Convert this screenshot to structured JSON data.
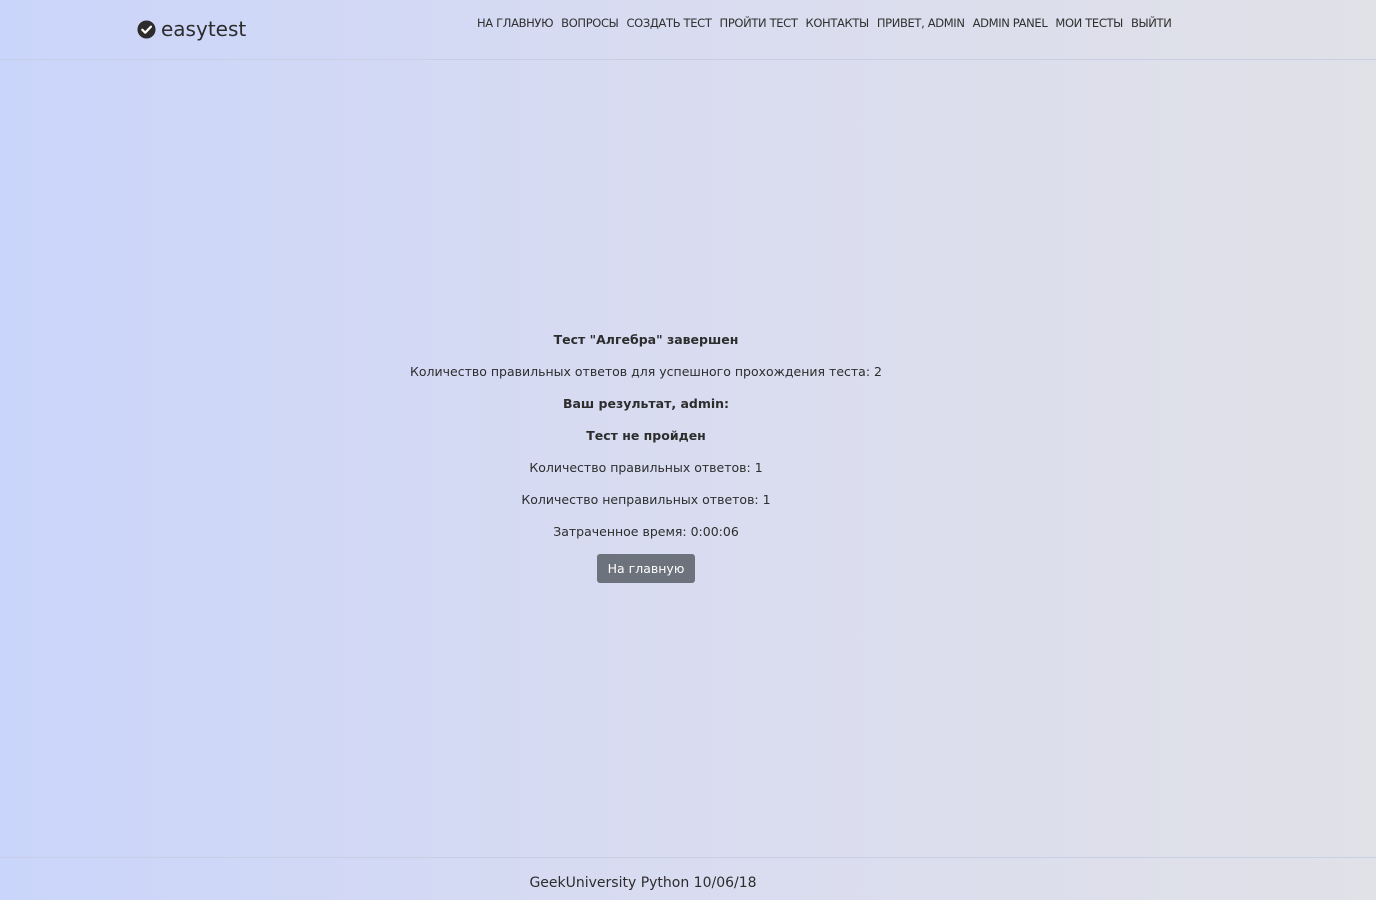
{
  "header": {
    "brand": "easytest",
    "brand_icon": "check-circle-icon",
    "nav": [
      "НА ГЛАВНУЮ",
      "ВОПРОСЫ",
      "СОЗДАТЬ ТЕСТ",
      "ПРОЙТИ ТЕСТ",
      "КОНТАКТЫ",
      "ПРИВЕТ, ADMIN",
      "ADMIN PANEL",
      "МОИ ТЕСТЫ",
      "ВЫЙТИ"
    ]
  },
  "result": {
    "title": "Тест \"Алгебра\" завершен",
    "required_correct": "Количество правильных ответов для успешного прохождения теста: 2",
    "your_result": "Ваш результат, admin:",
    "status": "Тест не пройден",
    "correct_count": "Количество правильных ответов: 1",
    "incorrect_count": "Количество неправильных ответов: 1",
    "time_spent": "Затраченное время: 0:00:06",
    "home_button": "На главную"
  },
  "footer": {
    "text": "GeekUniversity Python 10/06/18"
  },
  "colors": {
    "button_bg": "#6c737d",
    "gradient_left": "#cad5fb",
    "gradient_right": "#e1e1e8"
  }
}
